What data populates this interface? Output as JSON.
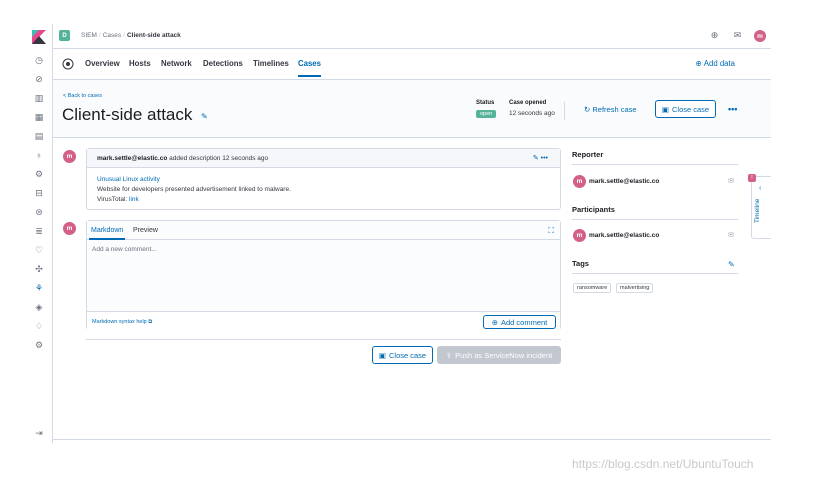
{
  "header": {
    "space_initial": "D",
    "breadcrumbs": [
      "SIEM",
      "Cases",
      "Client-side attack"
    ],
    "user_initial": "m"
  },
  "nav": {
    "tabs": [
      "Overview",
      "Hosts",
      "Network",
      "Detections",
      "Timelines",
      "Cases"
    ],
    "active_tab": "Cases",
    "add_data": "Add data"
  },
  "case": {
    "back_link": "< Back to cases",
    "title": "Client-side attack",
    "status_label": "Status",
    "status_value": "open",
    "opened_label": "Case opened",
    "opened_value": "12 seconds ago",
    "refresh_label": "Refresh case",
    "close_label": "Close case"
  },
  "description": {
    "avatar": "m",
    "author": "mark.settle@elastic.co",
    "action": "added description 12 seconds ago",
    "line1": "Unusual Linux activity",
    "line2": "Website for developers presented advertisement linked to malware.",
    "line3_prefix": "VirusTotal:",
    "line3_link": "link"
  },
  "editor": {
    "avatar": "m",
    "tab_markdown": "Markdown",
    "tab_preview": "Preview",
    "placeholder": "Add a new comment...",
    "help_link": "Markdown syntax help",
    "add_comment": "Add comment"
  },
  "footer_actions": {
    "close_case": "Close case",
    "push": "Push as ServiceNow incident"
  },
  "sidebar": {
    "reporter_title": "Reporter",
    "reporter": "mark.settle@elastic.co",
    "participants_title": "Participants",
    "participant": "mark.settle@elastic.co",
    "tags_title": "Tags",
    "tags": [
      "ransomware",
      "malvertising"
    ]
  },
  "timeline_flyout": {
    "label": "Timeline",
    "badge": "!"
  },
  "watermark": "https://blog.csdn.net/UbuntuTouch",
  "colors": {
    "accent": "#006bb4",
    "status_green": "#54b399",
    "avatar_pink": "#d36086"
  }
}
